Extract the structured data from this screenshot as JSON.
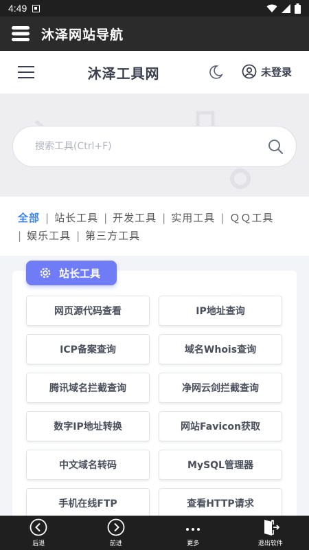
{
  "status_bar": {
    "time": "4:49"
  },
  "app_bar": {
    "title": "沐泽网站导航"
  },
  "site_header": {
    "brand": "沐泽工具网",
    "login_label": "未登录"
  },
  "search": {
    "placeholder": "搜索工具(Ctrl+F)"
  },
  "categories": [
    "全部",
    "站长工具",
    "开发工具",
    "实用工具",
    "ＱＱ工具",
    "娱乐工具",
    "第三方工具"
  ],
  "active_category": "全部",
  "section": {
    "badge": "站长工具",
    "tools": [
      "网页源代码查看",
      "IP地址查询",
      "ICP备案查询",
      "域名Whois查询",
      "腾讯域名拦截查询",
      "净网云剑拦截查询",
      "数字IP地址转换",
      "网站Favicon获取",
      "中文域名转码",
      "MySQL管理器",
      "手机在线FTP",
      "查看HTTP请求"
    ]
  },
  "bottom_nav": {
    "back": "后退",
    "forward": "前进",
    "more": "更多",
    "exit": "退出软件"
  },
  "colors": {
    "accent": "#3b82f6",
    "badge": "#6f7cf5",
    "bar": "#1f1f1f"
  }
}
